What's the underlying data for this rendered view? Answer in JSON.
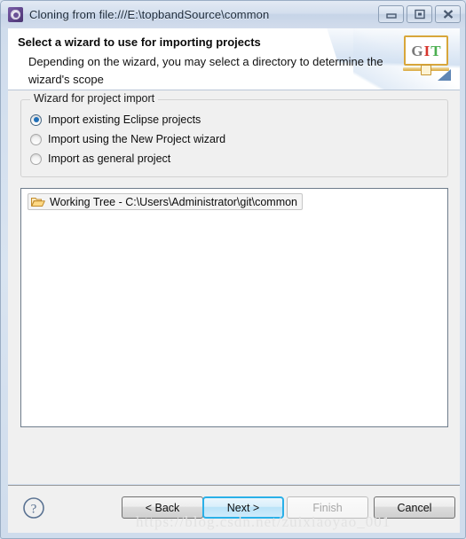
{
  "window": {
    "title": "Cloning from file:///E:\\topbandSource\\common",
    "app_icon": "eclipse-gear-icon",
    "controls": [
      {
        "name": "minimize",
        "glyph": "minimize-icon"
      },
      {
        "name": "restore",
        "glyph": "restore-icon"
      },
      {
        "name": "close",
        "glyph": "close-icon"
      }
    ]
  },
  "header": {
    "title": "Select a wizard to use for importing projects",
    "description": "Depending on the wizard, you may select a directory to determine the wizard's scope",
    "badge": {
      "name": "git-logo",
      "letters": [
        "G",
        "I",
        "T"
      ],
      "colors": {
        "g": "#7a7a7a",
        "i": "#d6342c",
        "t": "#4caf50",
        "frame": "#d8a63a"
      }
    }
  },
  "wizard_group": {
    "legend": "Wizard for project import",
    "options": [
      {
        "label": "Import existing Eclipse projects",
        "selected": true
      },
      {
        "label": "Import using the New Project wizard",
        "selected": false
      },
      {
        "label": "Import as general project",
        "selected": false
      }
    ]
  },
  "tree": {
    "items": [
      {
        "icon": "folder-open-icon",
        "label": "Working Tree - C:\\Users\\Administrator\\git\\common"
      }
    ]
  },
  "footer": {
    "help_icon": "help-question-icon",
    "buttons": [
      {
        "label": "< Back",
        "name": "back-button",
        "state": "enabled"
      },
      {
        "label": "Next >",
        "name": "next-button",
        "state": "default-focused"
      },
      {
        "label": "Finish",
        "name": "finish-button",
        "state": "disabled"
      },
      {
        "label": "Cancel",
        "name": "cancel-button",
        "state": "enabled"
      }
    ]
  },
  "watermark": "https://blog.csdn.net/zuixiaoyao_001",
  "theme": {
    "accent": "#2ab0e8",
    "panel_bg": "#f0f0f0",
    "frame_bg": "#d4dfed",
    "radio_selected": "#1f6fb8"
  }
}
